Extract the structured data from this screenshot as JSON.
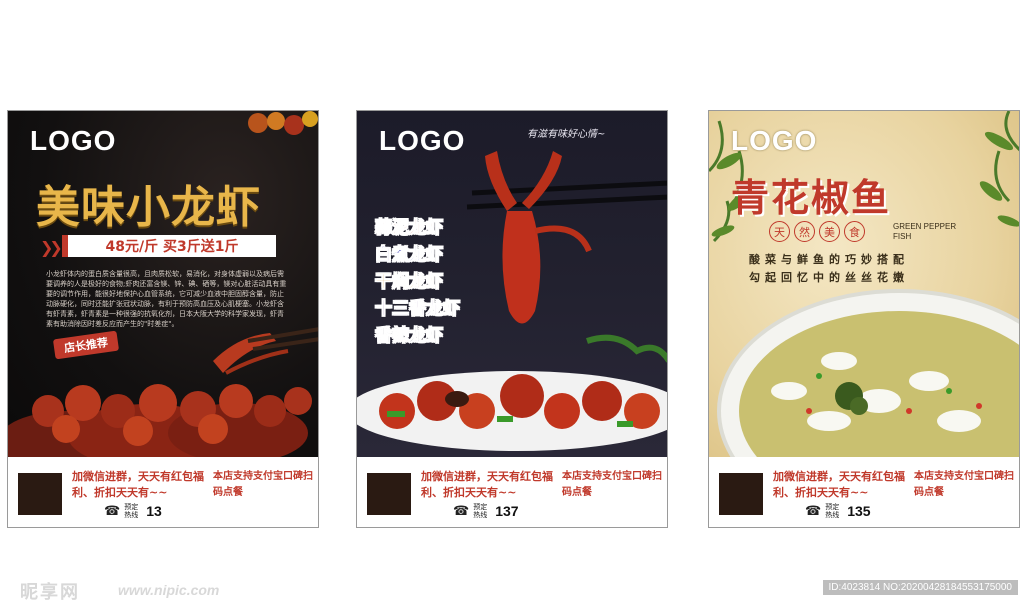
{
  "poster1": {
    "logo": "LOGO",
    "title": "美味小龙虾",
    "price": "48元/斤  买3斤送1斤",
    "description": "小龙虾体内的蛋白质含量很高，且肉质松软，易消化，对身体虚弱以及病后需要调养的人是极好的食物;虾肉还富含镁、锌、碘、硒等，镁对心脏活动具有重要的调节作用，能很好地保护心血管系统，它可减少血液中胆固醇含量，防止动脉硬化，同时还能扩张冠状动脉，有利于预防高血压及心肌梗塞。小龙虾含有虾青素，虾青素是一种很强的抗氧化剂，日本大阪大学的科学家发现，虾青素有助消除因时差反应而产生的\"时差症\"。",
    "badge": "店长推荐",
    "footer": {
      "wechat_text": "加微信进群，天天有红包福利、折扣天天有~~",
      "pay_text": "本店支持支付宝口碑扫码点餐",
      "phone_label": "预定热线",
      "phone_number": "13"
    }
  },
  "poster2": {
    "logo": "LOGO",
    "slogan": "有滋有味好心情~",
    "menu": [
      {
        "label": "蒜泥龙虾",
        "color": "#c0392b"
      },
      {
        "label": "白煮龙虾",
        "color": "#3b3fb8"
      },
      {
        "label": "干焖龙虾",
        "color": "#d08a10"
      },
      {
        "label": "十三香龙虾",
        "color": "#5a2a8a"
      },
      {
        "label": "香辣龙虾",
        "color": "#2a2a3a"
      }
    ],
    "footer": {
      "wechat_text": "加微信进群，天天有红包福利、折扣天天有~~",
      "pay_text": "本店支持支付宝口碑扫码点餐",
      "phone_label": "预定热线",
      "phone_number": "137"
    }
  },
  "poster3": {
    "logo": "LOGO",
    "title": "青花椒鱼",
    "tags": [
      "天",
      "然",
      "美",
      "食"
    ],
    "english": "GREEN PEPPER FISH",
    "lines": [
      "酸菜与鲜鱼的巧妙搭配",
      "勾起回忆中的丝丝花嫩"
    ],
    "footer": {
      "wechat_text": "加微信进群，天天有红包福利、折扣天天有~~",
      "pay_text": "本店支持支付宝口碑扫码点餐",
      "phone_label": "预定热线",
      "phone_number": "135"
    }
  },
  "watermark": {
    "site_logo": "昵享网",
    "site_url": "www.nipic.com",
    "id_text": "ID:4023814 NO:20200428184553175000"
  }
}
